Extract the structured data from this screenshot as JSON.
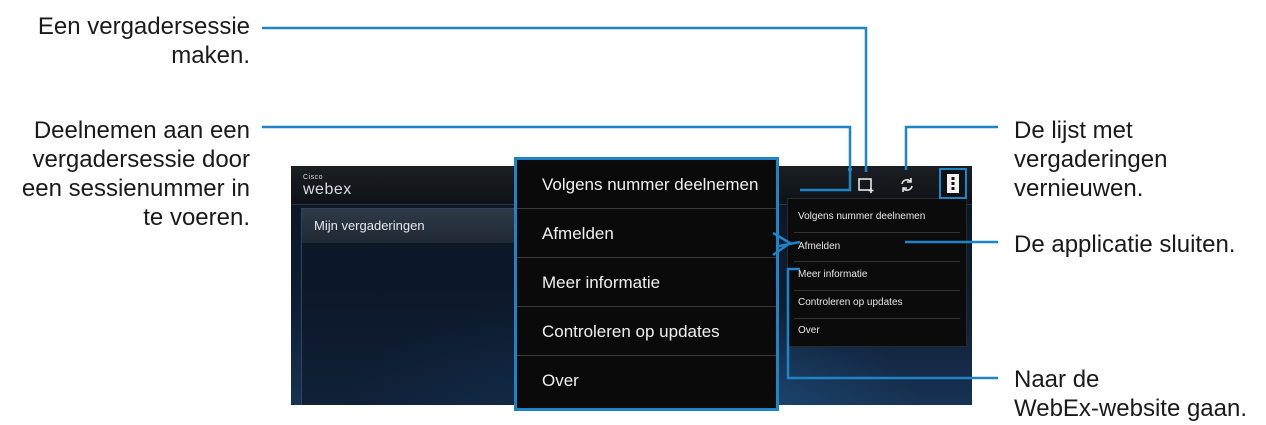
{
  "callouts": {
    "create_session": "Een vergadersessie\nmaken.",
    "join_by_number": "Deelnemen aan een\nvergadersessie door\neen sessienummer in\nte voeren.",
    "refresh_list": "De lijst met\nvergaderingen\nvernieuwen.",
    "close_app": "De applicatie sluiten.",
    "go_website": "Naar de\nWebEx-website gaan."
  },
  "app": {
    "logo_small": "Cisco",
    "logo_main": "webex",
    "sidebar_item": "Mijn vergaderingen",
    "actionbar_icons": [
      "new-meeting-icon",
      "refresh-icon",
      "overflow-menu-icon"
    ]
  },
  "menu": {
    "items": [
      "Volgens nummer deelnemen",
      "Afmelden",
      "Meer informatie",
      "Controleren op updates",
      "Over"
    ]
  },
  "colors": {
    "callout_line": "#1f84c6",
    "text": "#1a1a1a",
    "screen_bg": "#0a1424"
  }
}
